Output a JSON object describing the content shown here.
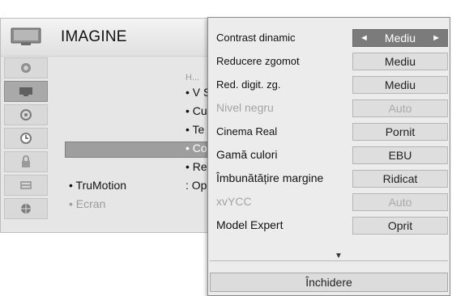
{
  "background_menu": {
    "title": "IMAGINE",
    "sidebar_icons": [
      "picture-icon",
      "screen-icon",
      "sound-icon",
      "clock-icon",
      "lock-icon",
      "options-icon",
      "network-icon"
    ],
    "items": [
      {
        "bullet": "•",
        "text": "H..."
      },
      {
        "bullet": "•",
        "text": "V S"
      },
      {
        "bullet": "•",
        "text": "Cu"
      },
      {
        "bullet": "•",
        "text": "Te"
      },
      {
        "bullet": "•",
        "text": "Co"
      },
      {
        "bullet": "•",
        "text": "Re"
      }
    ],
    "truMotion": {
      "label": "• TruMotion",
      "value": ": Op"
    },
    "ecran": "• Ecran"
  },
  "popup": {
    "rows": [
      {
        "label": "Contrast dinamic",
        "value": "Mediu",
        "selected": true,
        "dim": false
      },
      {
        "label": "Reducere zgomot",
        "value": "Mediu",
        "selected": false,
        "dim": false
      },
      {
        "label": "Red. digit. zg.",
        "value": "Mediu",
        "selected": false,
        "dim": false
      },
      {
        "label": "Nivel negru",
        "value": "Auto",
        "selected": false,
        "dim": true
      },
      {
        "label": "Cinema Real",
        "value": "Pornit",
        "selected": false,
        "dim": false
      },
      {
        "label": "Gamă culori",
        "value": "EBU",
        "selected": false,
        "dim": false
      },
      {
        "label": "Îmbunătățire margine",
        "value": "Ridicat",
        "selected": false,
        "dim": false
      },
      {
        "label": "xvYCC",
        "value": "Auto",
        "selected": false,
        "dim": true
      },
      {
        "label": "Model Expert",
        "value": "Oprit",
        "selected": false,
        "dim": false
      }
    ],
    "arrow_left": "◄",
    "arrow_right": "►",
    "scroll_down": "▼",
    "close_label": "Închidere"
  },
  "colors": {
    "selected_value_bg": "#7b7b7b",
    "dim_text": "#a3a3a3",
    "background": "#e6e6e6"
  }
}
